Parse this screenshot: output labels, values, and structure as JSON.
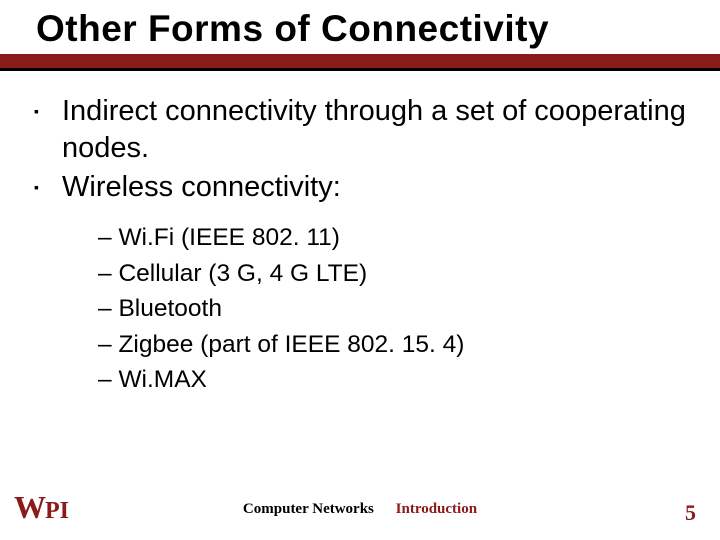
{
  "title": "Other Forms of Connectivity",
  "bullets": [
    "Indirect connectivity through a set of cooperating nodes.",
    "Wireless connectivity:"
  ],
  "sub": [
    "Wi.Fi   (IEEE 802. 11)",
    "Cellular (3 G, 4 G LTE)",
    "Bluetooth",
    "Zigbee (part of IEEE 802. 15. 4)",
    "Wi.MAX"
  ],
  "footer": {
    "left_course": "Computer Networks",
    "right_course": "Introduction",
    "page": "5",
    "logo_w": "W",
    "logo_pi": "PI"
  },
  "colors": {
    "brand": "#8b1a1a"
  }
}
